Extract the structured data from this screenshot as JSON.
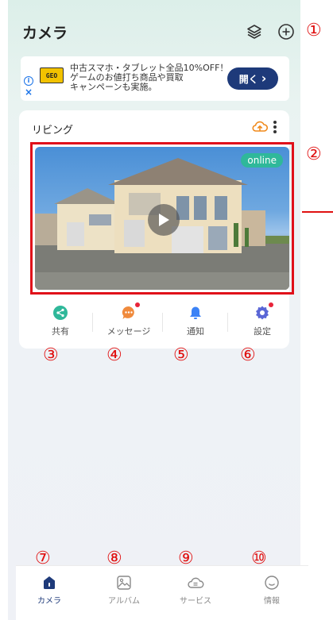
{
  "header": {
    "title": "カメラ",
    "icons": [
      "layers-icon",
      "add-circle-icon"
    ]
  },
  "ad": {
    "logo_text": "GEO",
    "info_icon": "i",
    "close_icon": "×",
    "line1": "中古スマホ・タブレット全品10%OFF！",
    "line2": "ゲームのお値打ち商品や買取",
    "line3": "キャンペーンも実施。",
    "button_label": "開く",
    "button_chevron": "›"
  },
  "camera_card": {
    "name": "リビング",
    "status_badge": "online",
    "actions": [
      {
        "label": "共有",
        "icon": "share-icon",
        "color": "#2fb89a",
        "badge": false
      },
      {
        "label": "メッセージ",
        "icon": "message-icon",
        "color": "#f08a3c",
        "badge": true
      },
      {
        "label": "通知",
        "icon": "bell-icon",
        "color": "#3b82f6",
        "badge": false
      },
      {
        "label": "設定",
        "icon": "gear-icon",
        "color": "#5a66d6",
        "badge": true
      }
    ]
  },
  "tabbar": {
    "tabs": [
      {
        "label": "カメラ",
        "icon": "camera-home-icon",
        "active": true
      },
      {
        "label": "アルバム",
        "icon": "album-icon",
        "active": false
      },
      {
        "label": "サービス",
        "icon": "service-icon",
        "active": false
      },
      {
        "label": "情報",
        "icon": "info-face-icon",
        "active": false
      }
    ]
  },
  "annotations": {
    "c1": "①",
    "c2": "②",
    "c3": "③",
    "c4": "④",
    "c5": "⑤",
    "c6": "⑥",
    "c7": "⑦",
    "c8": "⑧",
    "c9": "⑨",
    "c10": "⑩"
  },
  "colors": {
    "accent": "#2fb89a",
    "primary": "#1e3a7a",
    "annotation": "#e01010"
  }
}
